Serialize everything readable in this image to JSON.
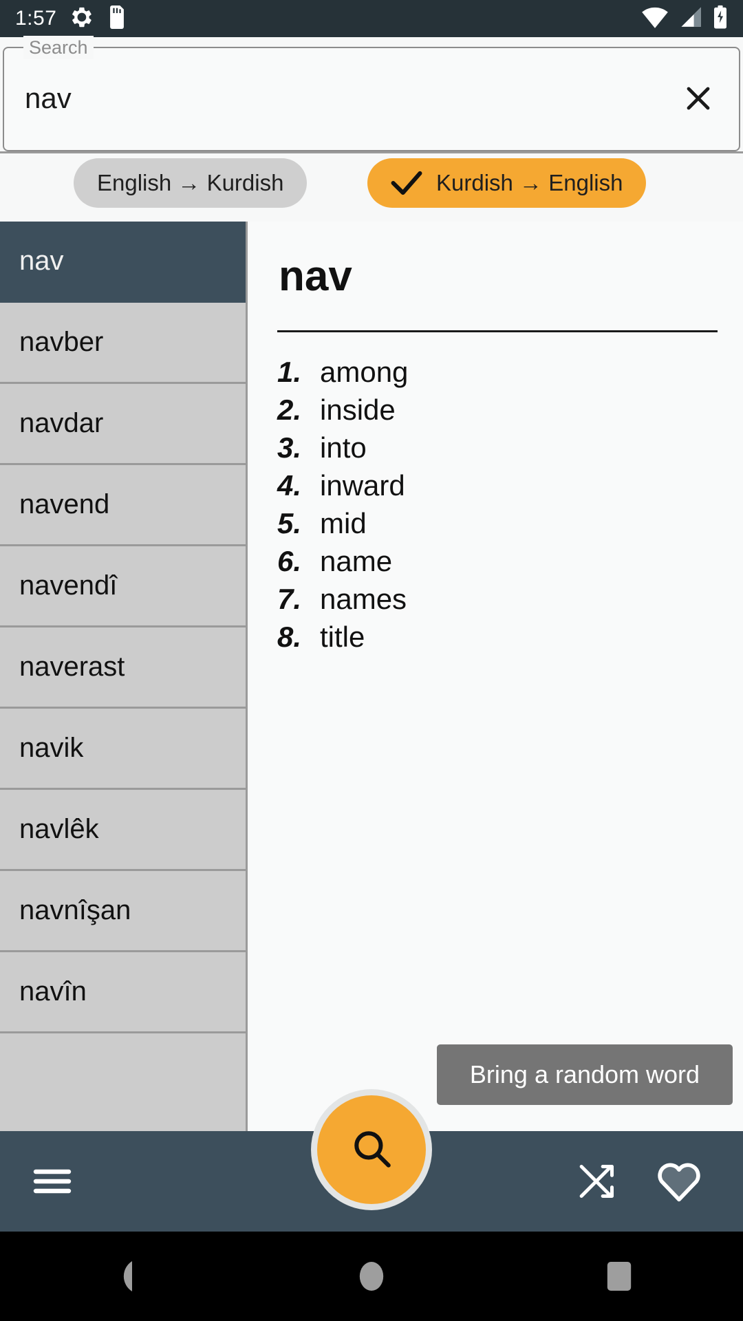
{
  "status_bar": {
    "time": "1:57",
    "icons": [
      "gear-icon",
      "sd-card-icon",
      "wifi-icon",
      "cellular-signal-icon",
      "battery-charging-icon"
    ]
  },
  "search": {
    "label": "Search",
    "value": "nav",
    "placeholder": "Search",
    "clear_icon": "close-icon"
  },
  "direction_chips": [
    {
      "label": "English → Kurdish",
      "active": false
    },
    {
      "label": "Kurdish → English",
      "active": true,
      "check_icon": "check-icon"
    }
  ],
  "word_list": {
    "selected_index": 0,
    "items": [
      "nav",
      "navber",
      "navdar",
      "navend",
      "navendî",
      "naverast",
      "navik",
      "navlêk",
      "navnîşan",
      "navîn"
    ]
  },
  "definition": {
    "headword": "nav",
    "senses": [
      {
        "num": "1.",
        "text": "among"
      },
      {
        "num": "2.",
        "text": "inside"
      },
      {
        "num": "3.",
        "text": "into"
      },
      {
        "num": "4.",
        "text": "inward"
      },
      {
        "num": "5.",
        "text": "mid"
      },
      {
        "num": "6.",
        "text": "name"
      },
      {
        "num": "7.",
        "text": "names"
      },
      {
        "num": "8.",
        "text": "title"
      }
    ]
  },
  "tooltip": {
    "text": "Bring a random word"
  },
  "fab": {
    "icon": "search-icon"
  },
  "bottom_bar": {
    "menu_icon": "hamburger-menu-icon",
    "shuffle_icon": "shuffle-icon",
    "favorite_icon": "heart-outline-icon"
  },
  "android_nav": {
    "back": "back-triangle-icon",
    "home": "home-circle-icon",
    "recents": "recents-square-icon"
  },
  "colors": {
    "accent": "#f5a832",
    "dark": "#3d4f5c",
    "status_bar": "#263238",
    "list_bg": "#cccccc",
    "page_bg": "#f7f8f8"
  }
}
